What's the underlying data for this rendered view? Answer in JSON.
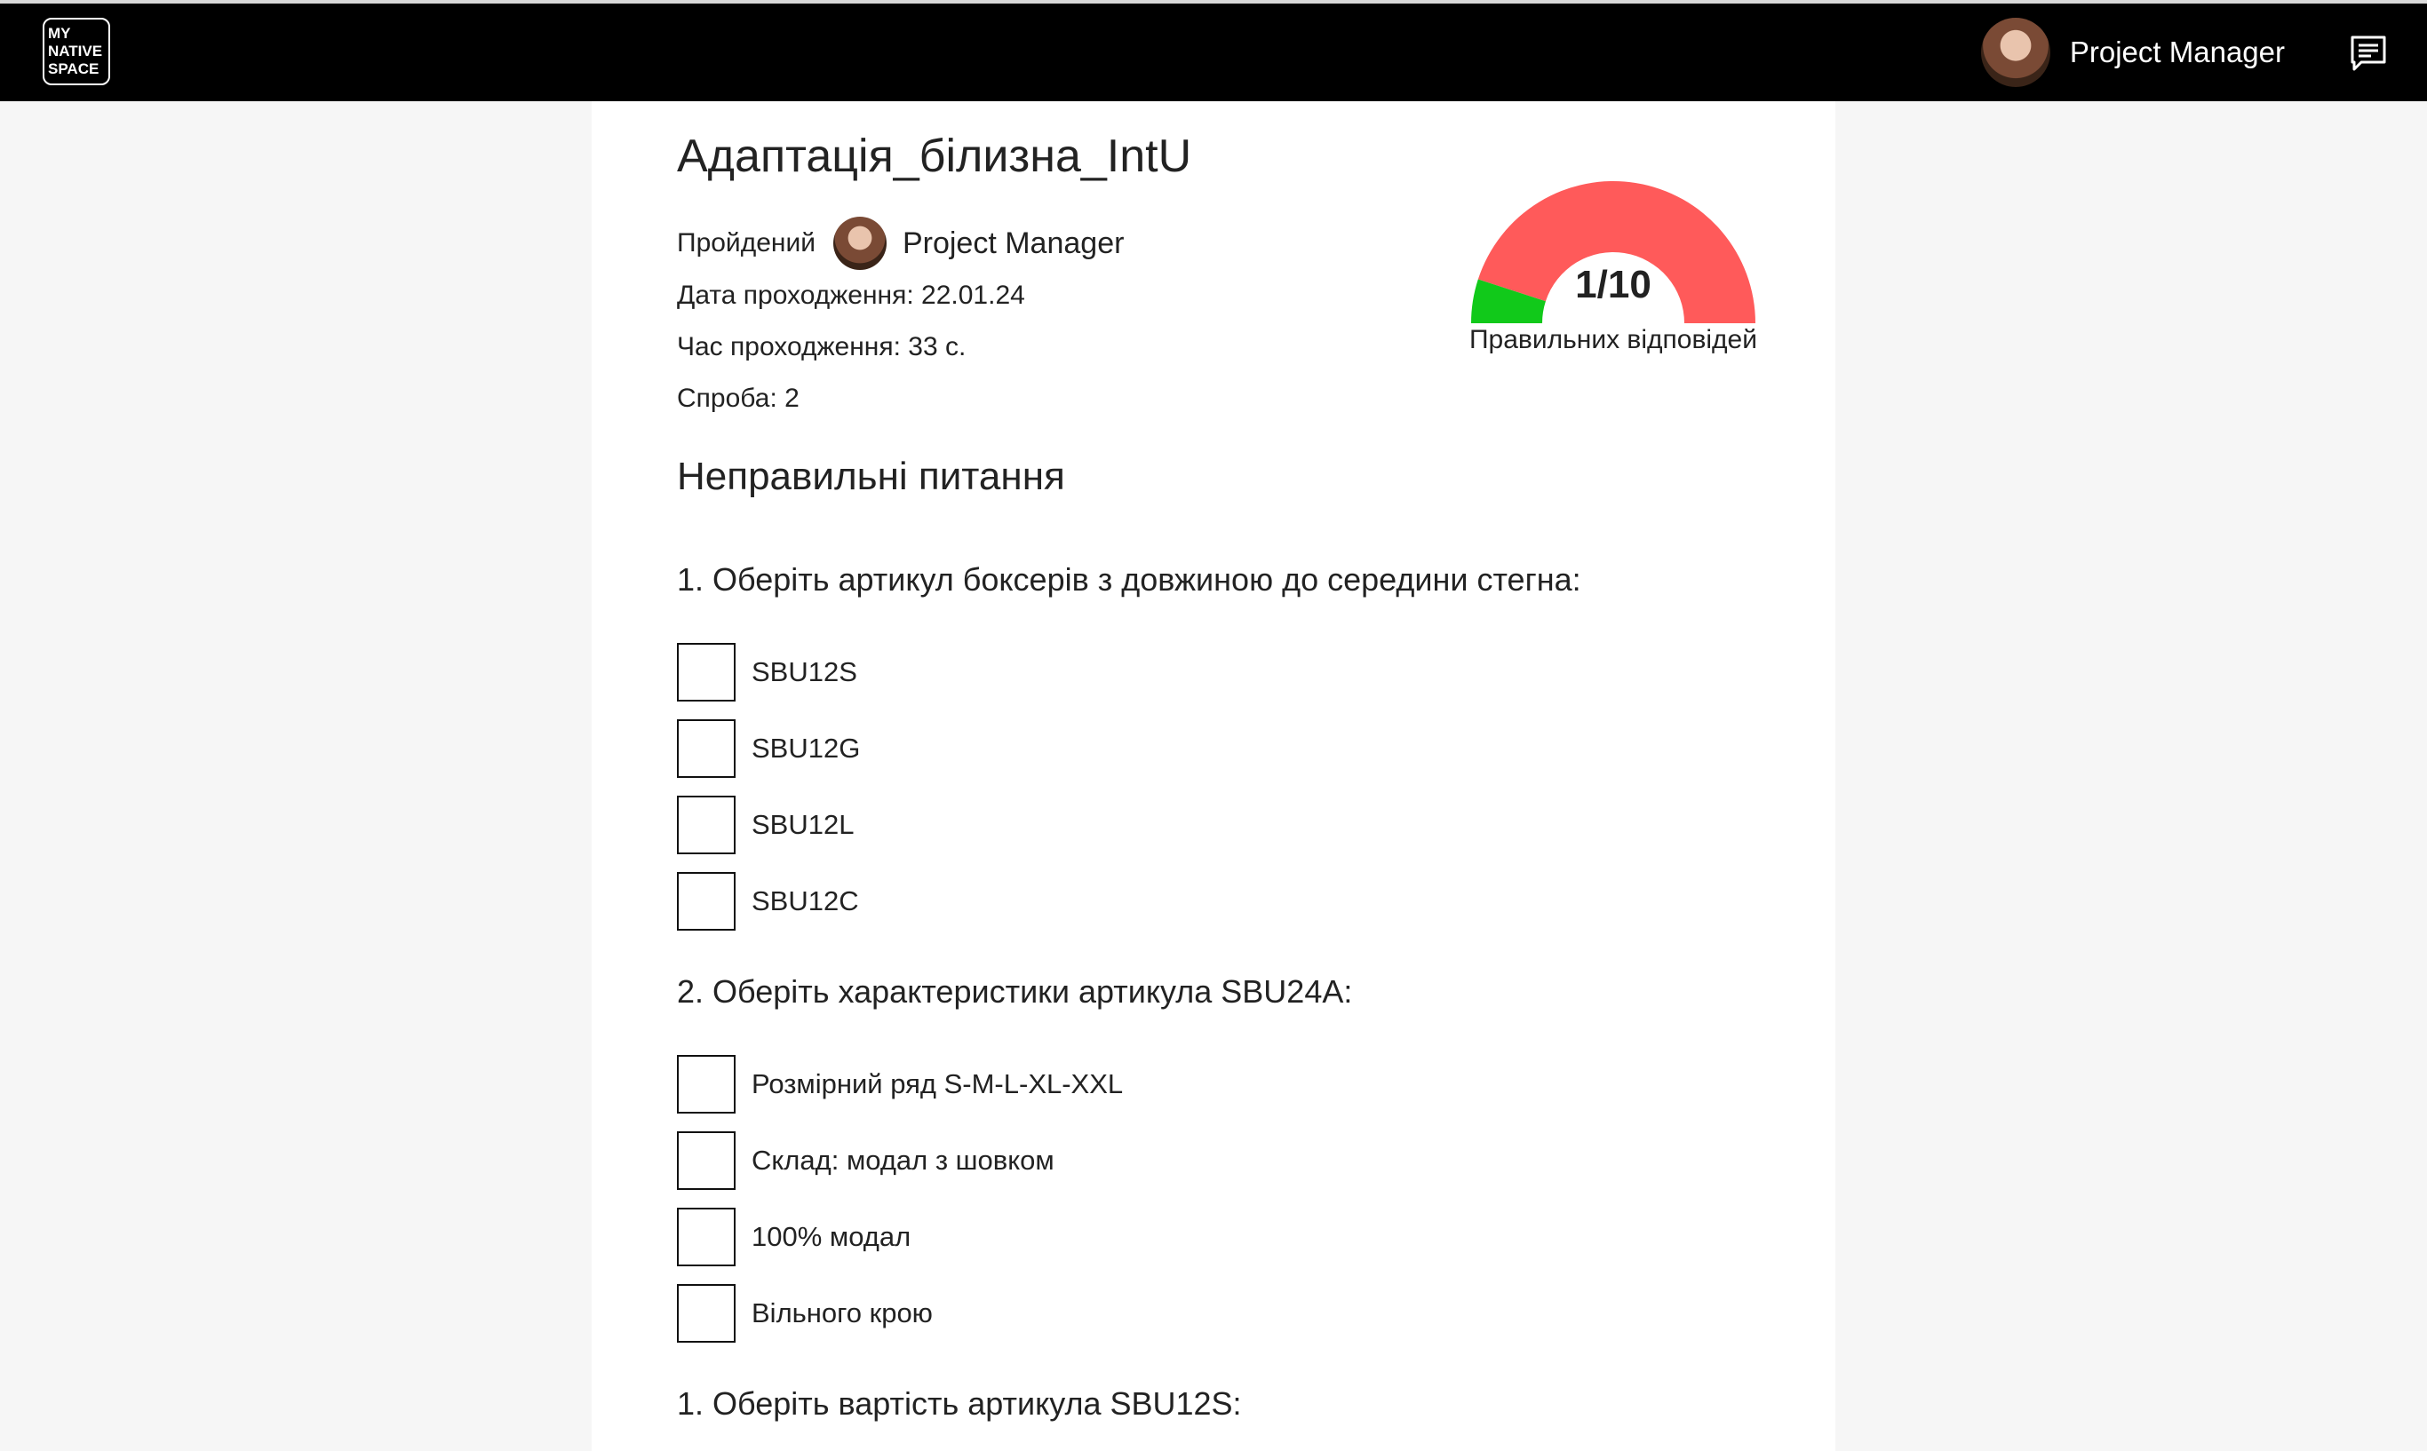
{
  "nav": {
    "logo": [
      "MY",
      "NATIVE",
      "SPACE"
    ],
    "user_name": "Project Manager"
  },
  "test": {
    "title": "Адаптація_білизна_IntU",
    "passed_label": "Пройдений",
    "passed_by": "Project Manager",
    "date": "Дата проходження: 22.01.24",
    "time": "Час проходження: 33 с.",
    "attempt": "Спроба: 2"
  },
  "gauge": {
    "score": "1/10",
    "label": "Правильних відповідей",
    "correct": 1,
    "total": 10,
    "color_correct": "#11c91a",
    "color_wrong": "#ff5a5a"
  },
  "section_title": "Неправильні питання",
  "questions": [
    {
      "text": "1. Оберіть артикул боксерів з довжиною до середини стегна:",
      "options": [
        "SBU12S",
        "SBU12G",
        "SBU12L",
        "SBU12C"
      ]
    },
    {
      "text": "2. Оберіть характеристики артикула SBU24A:",
      "options": [
        "Розмірний ряд S-M-L-XL-XXL",
        "Склад: модал з шовком",
        "100% модал",
        "Вільного крою"
      ]
    },
    {
      "text": "1. Оберіть вартість артикула SBU12S:",
      "options": []
    }
  ]
}
